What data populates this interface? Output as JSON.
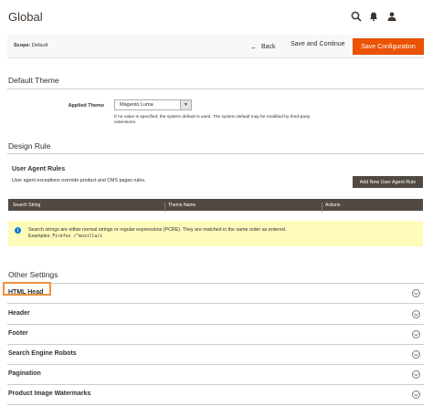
{
  "header": {
    "title": "Global",
    "icons": [
      "search-icon",
      "bell-icon",
      "user-icon"
    ]
  },
  "actions": {
    "scope_label": "Scope:",
    "scope_value": "Default",
    "back_label": "Back",
    "save_continue_label": "Save and Continue",
    "save_config_label": "Save Configuration"
  },
  "default_theme": {
    "title": "Default Theme",
    "field_label": "Applied Theme",
    "select_value": "Magento Luma",
    "note": "If no value is specified, the system default is used. The system default may be modified by third-party extensions."
  },
  "design_rule": {
    "title": "Design Rule",
    "subtitle": "User Agent Rules",
    "description": "User agent exceptions override product and CMS pages rules.",
    "add_button": "Add New User Agent Rule",
    "columns": [
      "Search String",
      "Theme Name",
      "Actions"
    ],
    "message_line1": "Search strings are either normal strings or regular expressions (PCRE). They are matched in the same order as entered.",
    "message_examples_label": "Examples:",
    "message_examples_code": "Firefox /^mozilla/i"
  },
  "other_settings": {
    "title": "Other Settings",
    "items": [
      "HTML Head",
      "Header",
      "Footer",
      "Search Engine Robots",
      "Pagination",
      "Product Image Watermarks"
    ]
  },
  "colors": {
    "accent": "#eb5202",
    "dark_button": "#514943",
    "message_bg": "#fffbbb",
    "highlight": "#f1923c"
  }
}
